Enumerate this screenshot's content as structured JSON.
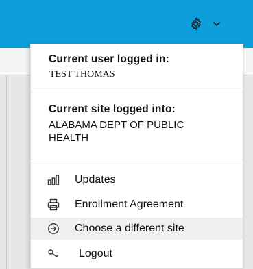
{
  "header": {
    "settings_icon": "gear-icon",
    "dropdown_icon": "chevron-down-icon"
  },
  "menu": {
    "user_section": {
      "heading": "Current user logged in:",
      "value": "TEST THOMAS"
    },
    "site_section": {
      "heading": "Current site logged into:",
      "value": "ALABAMA DEPT OF PUBLIC HEALTH"
    },
    "items": [
      {
        "label": "Updates",
        "icon": "bar-chart-icon"
      },
      {
        "label": "Enrollment Agreement",
        "icon": "printer-icon"
      },
      {
        "label": "Choose a different site",
        "icon": "circle-arrow-right-icon",
        "highlighted": true
      },
      {
        "label": "Logout",
        "icon": "key-icon"
      }
    ]
  },
  "colors": {
    "topbar": "#0c9fdb",
    "menu_bg": "#ffffff",
    "item_highlight": "#f0f0f0"
  }
}
